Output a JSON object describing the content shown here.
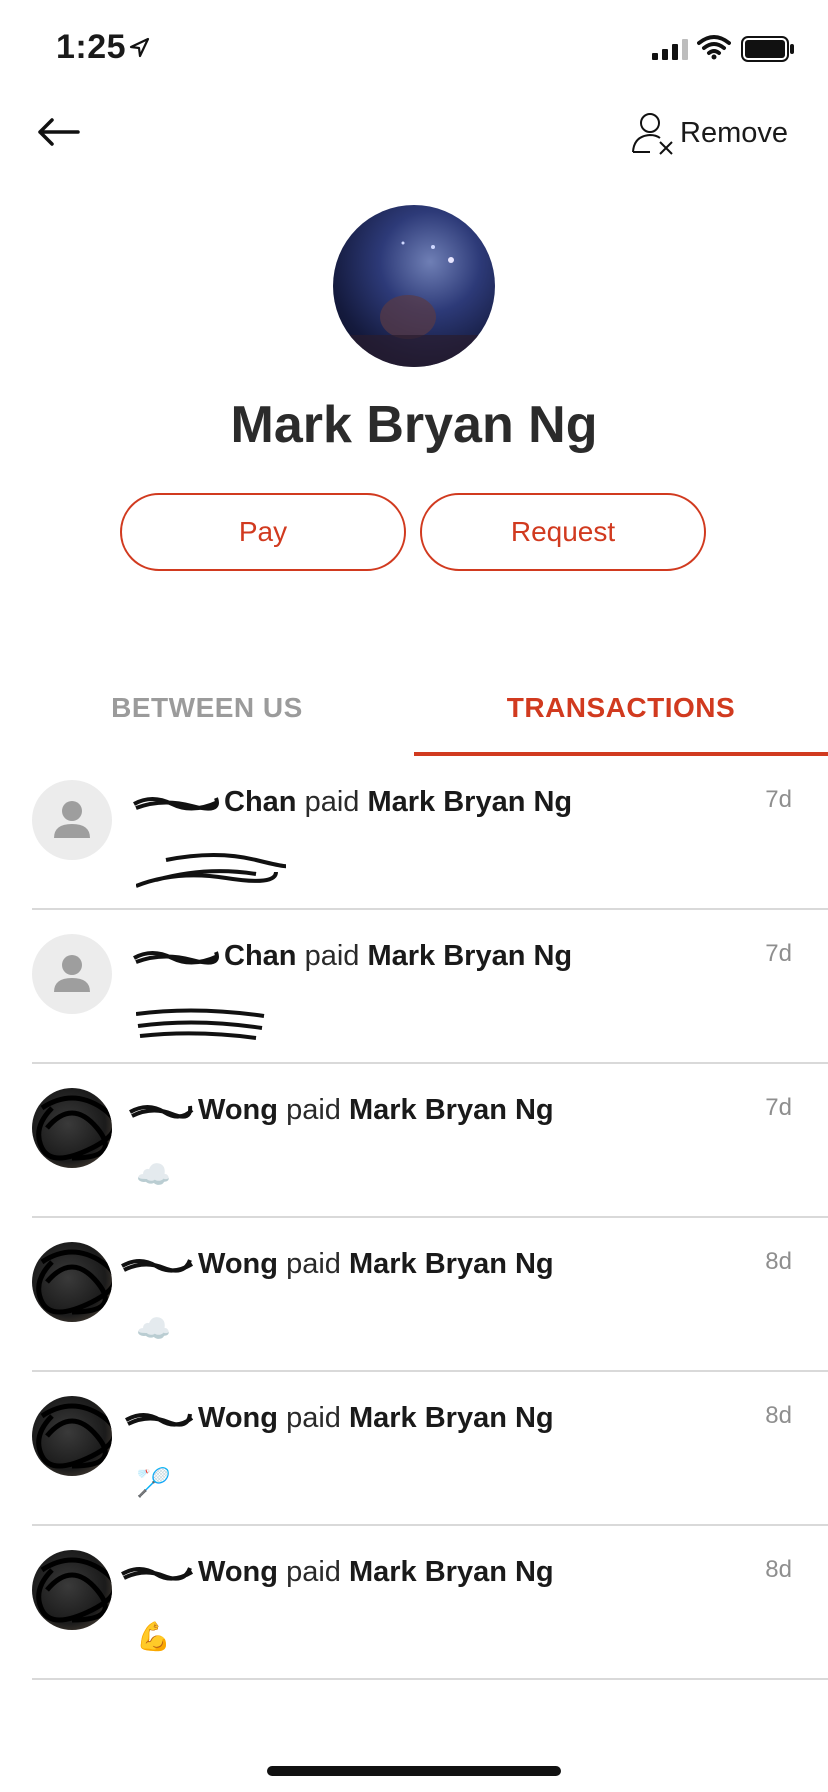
{
  "status": {
    "time": "1:25"
  },
  "nav": {
    "remove_label": "Remove"
  },
  "profile": {
    "name": "Mark Bryan Ng"
  },
  "actions": {
    "pay_label": "Pay",
    "request_label": "Request"
  },
  "tabs": {
    "between_label": "BETWEEN US",
    "transactions_label": "TRANSACTIONS",
    "active": "TRANSACTIONS"
  },
  "colors": {
    "accent": "#d13a1f",
    "inactive_tab": "#9b9b9b",
    "divider": "#d9d9d9"
  },
  "transactions": [
    {
      "payer_last": "Chan",
      "verb": "paid",
      "payee": "Mark Bryan Ng",
      "time": "7d",
      "note": "",
      "avatar": "placeholder"
    },
    {
      "payer_last": "Chan",
      "verb": "paid",
      "payee": "Mark Bryan Ng",
      "time": "7d",
      "note": "",
      "avatar": "placeholder"
    },
    {
      "payer_last": "Wong",
      "verb": "paid",
      "payee": "Mark Bryan Ng",
      "time": "7d",
      "note": "☁️",
      "avatar": "photo"
    },
    {
      "payer_last": "Wong",
      "verb": "paid",
      "payee": "Mark Bryan Ng",
      "time": "8d",
      "note": "☁️",
      "avatar": "photo"
    },
    {
      "payer_last": "Wong",
      "verb": "paid",
      "payee": "Mark Bryan Ng",
      "time": "8d",
      "note": "🏸",
      "avatar": "photo"
    },
    {
      "payer_last": "Wong",
      "verb": "paid",
      "payee": "Mark Bryan Ng",
      "time": "8d",
      "note": "💪",
      "avatar": "photo"
    }
  ]
}
